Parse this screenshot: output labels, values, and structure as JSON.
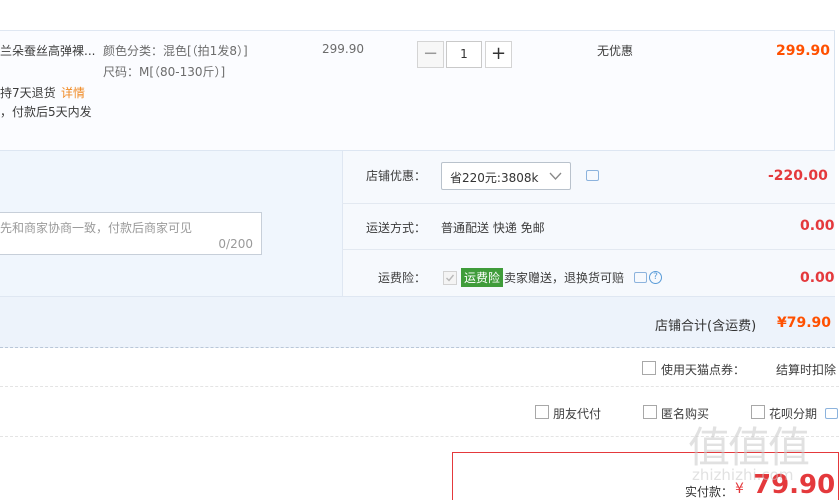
{
  "item": {
    "title": "兰朵蚕丝高弹裸...",
    "sku_color": "颜色分类：混色[（拍1发8）]",
    "sku_size": "尺码：M[（80-130斤）]",
    "return_policy": "持7天退货",
    "detail_link": "详情",
    "ship_note": "，付款后5天内发",
    "unit_price": "299.90",
    "quantity": "1",
    "minus": "−",
    "plus": "+",
    "discount": "无优惠",
    "subtotal": "299.90"
  },
  "shop": {
    "note_placeholder": "先和商家协商一致，付款后商家可见",
    "note_counter": "0/200",
    "coupon_label": "店铺优惠：",
    "coupon_selected": "省220元:3808k",
    "coupon_amount": "-220.00",
    "shipping_label": "运送方式：",
    "shipping_value": "普通配送 快递 免邮",
    "shipping_amount": "0.00",
    "insurance_label": "运费险：",
    "insurance_badge": "运费险",
    "insurance_desc": "卖家赠送，退换货可赔",
    "insurance_amount": "0.00",
    "total_label": "店铺合计(含运费)",
    "total_amount": "¥79.90"
  },
  "options": {
    "tmall_points": "使用天猫点券：",
    "checkout_deduct": "结算时扣除",
    "friend_pay": "朋友代付",
    "anonymous": "匿名购买",
    "huabei": "花呗分期"
  },
  "payment": {
    "label": "实付款：",
    "currency": "¥",
    "amount": "79.90"
  },
  "watermark": {
    "logo": "值值值",
    "url": "zhizhizhi.com"
  }
}
